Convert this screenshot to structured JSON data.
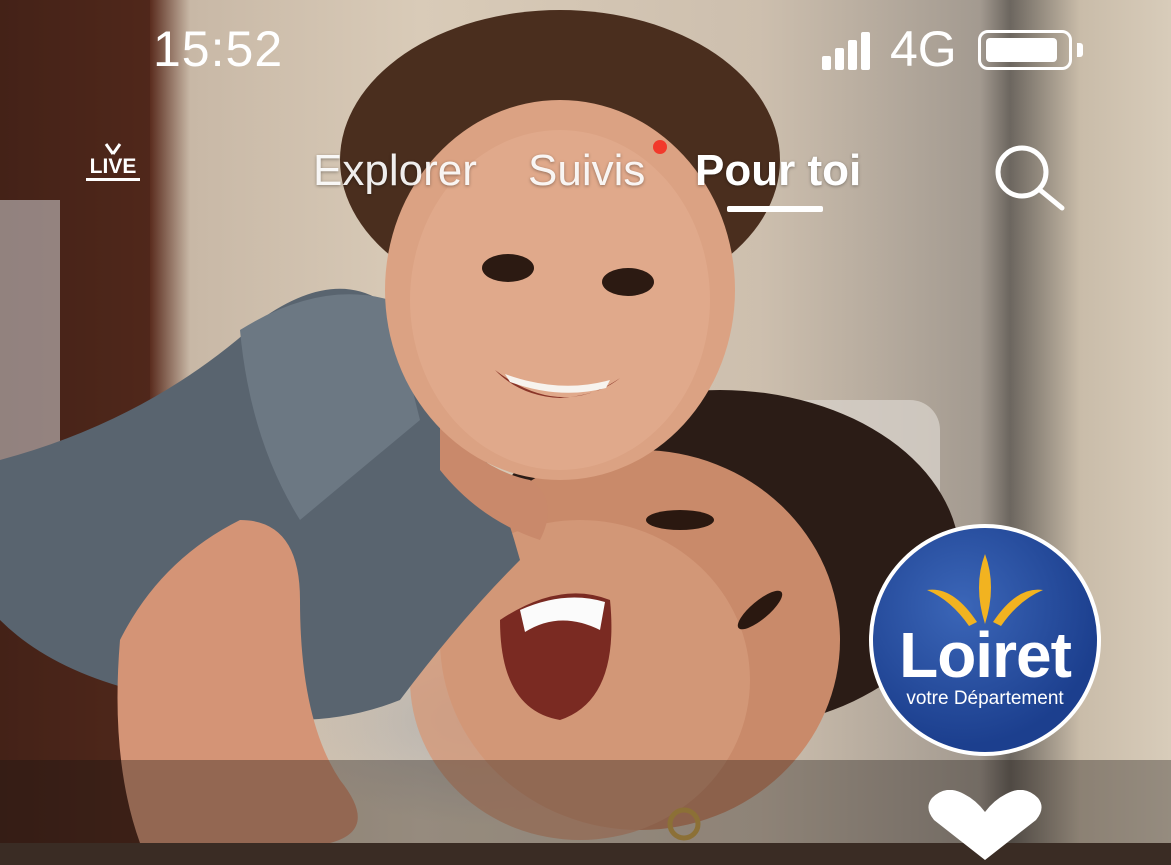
{
  "status_bar": {
    "time": "15:52",
    "network": "4G"
  },
  "nav": {
    "live_label": "LIVE",
    "tabs": [
      {
        "label": "Explorer",
        "active": false
      },
      {
        "label": "Suivis",
        "active": false,
        "has_notification_dot": true
      },
      {
        "label": "Pour toi",
        "active": true
      }
    ]
  },
  "badge": {
    "title": "Loiret",
    "subtitle": "votre Département"
  },
  "icons": {
    "live": "tv-live-icon",
    "search": "search-icon",
    "like": "heart-icon"
  },
  "colors": {
    "notification_dot": "#f2392b",
    "badge_blue": "#1c3f8e",
    "badge_gold": "#f2b320"
  }
}
